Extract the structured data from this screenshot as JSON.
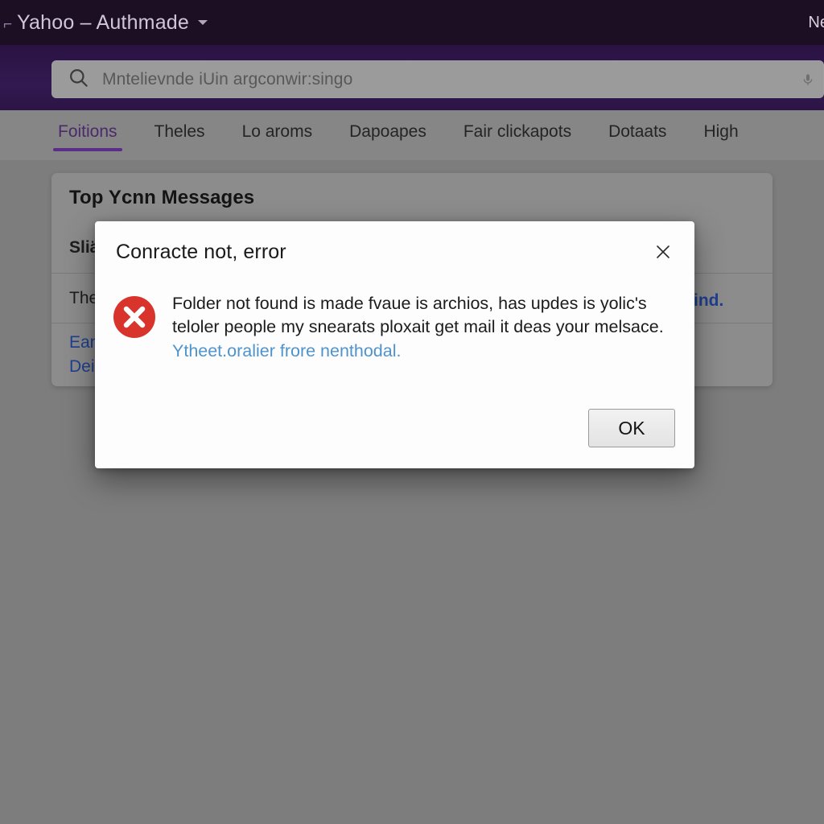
{
  "window": {
    "tab_fragment": "⌐",
    "title": "Yahoo – Authmade",
    "caret_icon": "chevron-down-icon",
    "right_label": "Ne"
  },
  "search": {
    "icon": "search-icon",
    "value": "Mntelievnde iUin argconwir:singo",
    "trailing_icon": "microphone-icon"
  },
  "tabs": [
    {
      "label": "Foitions",
      "active": true
    },
    {
      "label": "Theles",
      "active": false
    },
    {
      "label": "Lo aroms",
      "active": false
    },
    {
      "label": "Dapoapes",
      "active": false
    },
    {
      "label": "Fair clickapots",
      "active": false
    },
    {
      "label": "Dotaats",
      "active": false
    },
    {
      "label": "High",
      "active": false
    }
  ],
  "card": {
    "header": "Top Ycnn Messages",
    "rows": [
      {
        "text": "Sliä",
        "style": "headline"
      },
      {
        "text": "The",
        "link_tail": "ind.",
        "style": "normal"
      },
      {
        "text": "Ean",
        "sub_text": "Dei",
        "style": "link"
      }
    ]
  },
  "dialog": {
    "title": "Conracte not, error",
    "close_icon": "close-icon",
    "status_icon": "error-icon",
    "message": "Folder not found is made fvaue is archios, has updes is yolic's teloler people my snearats ploxait get mail it deas your melsace.",
    "message_link": "Ytheet.oralier frore nenthodal.",
    "ok_label": "OK"
  },
  "colors": {
    "titlebar_bg": "#1c0f24",
    "search_band": "#2e1548",
    "accent_purple": "#5b2d86",
    "page_bg": "#7d7d7d",
    "card_bg": "#8c8c8c",
    "error_red": "#d9342b",
    "link_blue": "#4f93cd",
    "row_link_blue": "#1f3f8f"
  }
}
